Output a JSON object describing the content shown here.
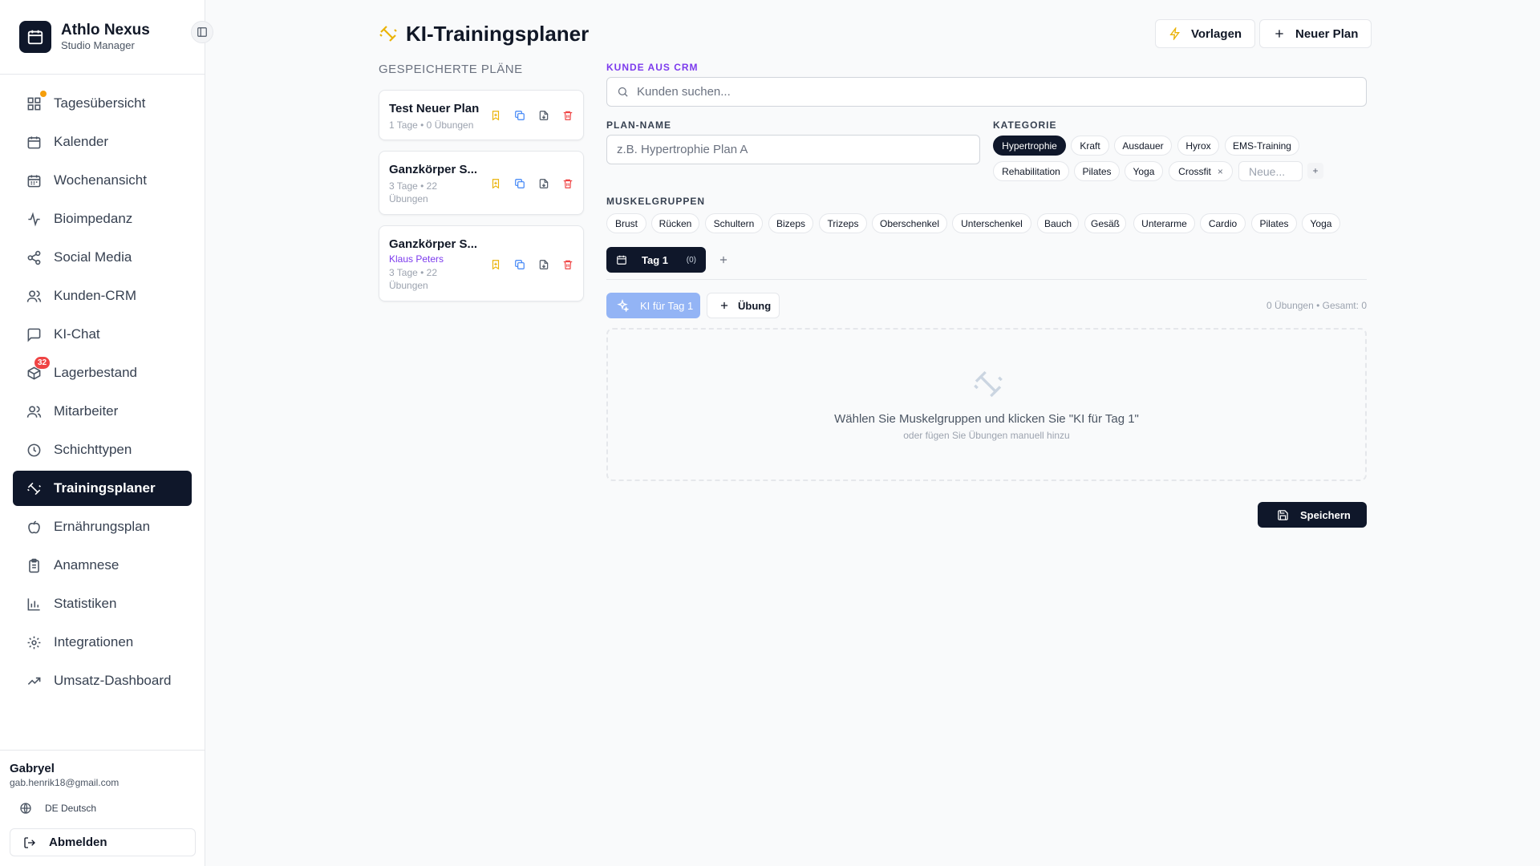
{
  "sidebar": {
    "brand_title": "Athlo Nexus",
    "brand_subtitle": "Studio Manager",
    "items": [
      {
        "label": "Tagesübersicht",
        "icon": "dashboard-icon",
        "dot": true
      },
      {
        "label": "Kalender",
        "icon": "calendar-icon"
      },
      {
        "label": "Wochenansicht",
        "icon": "calendar-week-icon"
      },
      {
        "label": "Bioimpedanz",
        "icon": "activity-icon"
      },
      {
        "label": "Social Media",
        "icon": "share-icon"
      },
      {
        "label": "Kunden-CRM",
        "icon": "users-icon"
      },
      {
        "label": "KI-Chat",
        "icon": "chat-icon"
      },
      {
        "label": "Lagerbestand",
        "icon": "package-icon",
        "badge": "32"
      },
      {
        "label": "Mitarbeiter",
        "icon": "staff-icon"
      },
      {
        "label": "Schichttypen",
        "icon": "clock-icon"
      },
      {
        "label": "Trainingsplaner",
        "icon": "dumbbell-icon",
        "active": true
      },
      {
        "label": "Ernährungsplan",
        "icon": "apple-icon"
      },
      {
        "label": "Anamnese",
        "icon": "clipboard-icon"
      },
      {
        "label": "Statistiken",
        "icon": "bar-chart-icon"
      },
      {
        "label": "Integrationen",
        "icon": "gear-icon"
      },
      {
        "label": "Umsatz-Dashboard",
        "icon": "trending-up-icon"
      }
    ],
    "user_name": "Gabryel",
    "user_email": "gab.henrik18@gmail.com",
    "language": "DE Deutsch",
    "logout": "Abmelden"
  },
  "header": {
    "title": "KI-Trainingsplaner",
    "templates_button": "Vorlagen",
    "new_plan_button": "Neuer Plan"
  },
  "saved_plans": {
    "title": "GESPEICHERTE PLÄNE",
    "plans": [
      {
        "name": "Test Neuer Plan",
        "meta": "1 Tage • 0 Übungen"
      },
      {
        "name": "Ganzkörper S...",
        "meta": "3 Tage • 22 Übungen"
      },
      {
        "name": "Ganzkörper S...",
        "client": "Klaus Peters",
        "meta": "3 Tage • 22 Übungen"
      }
    ]
  },
  "form": {
    "crm_label": "KUNDE AUS CRM",
    "crm_placeholder": "Kunden suchen...",
    "plan_name_label": "PLAN-NAME",
    "plan_name_placeholder": "z.B. Hypertrophie Plan A",
    "category_label": "KATEGORIE",
    "categories": [
      "Hypertrophie",
      "Kraft",
      "Ausdauer",
      "Hyrox",
      "EMS-Training",
      "Rehabilitation",
      "Pilates",
      "Yoga",
      "Crossfit"
    ],
    "active_category": "Hypertrophie",
    "new_category_placeholder": "Neue...",
    "muscle_label": "MUSKELGRUPPEN",
    "muscles": [
      "Brust",
      "Rücken",
      "Schultern",
      "Bizeps",
      "Trizeps",
      "Oberschenkel",
      "Unterschenkel",
      "Bauch",
      "Gesäß",
      "Unterarme",
      "Cardio",
      "Pilates",
      "Yoga"
    ]
  },
  "days": {
    "tab_label": "Tag 1",
    "tab_count": "(0)",
    "ai_button": "KI für Tag 1",
    "exercise_button": "Übung",
    "totals": "0 Übungen • Gesamt: 0",
    "empty_main": "Wählen Sie Muskelgruppen und klicken Sie \"KI für Tag 1\"",
    "empty_sub": "oder fügen Sie Übungen manuell hinzu"
  },
  "save_button": "Speichern",
  "colors": {
    "primary": "#0f172a",
    "accent_purple": "#7c3aed",
    "ai_button": "#93b4f5",
    "badge_red": "#ef4444",
    "dot_amber": "#f59e0b"
  }
}
